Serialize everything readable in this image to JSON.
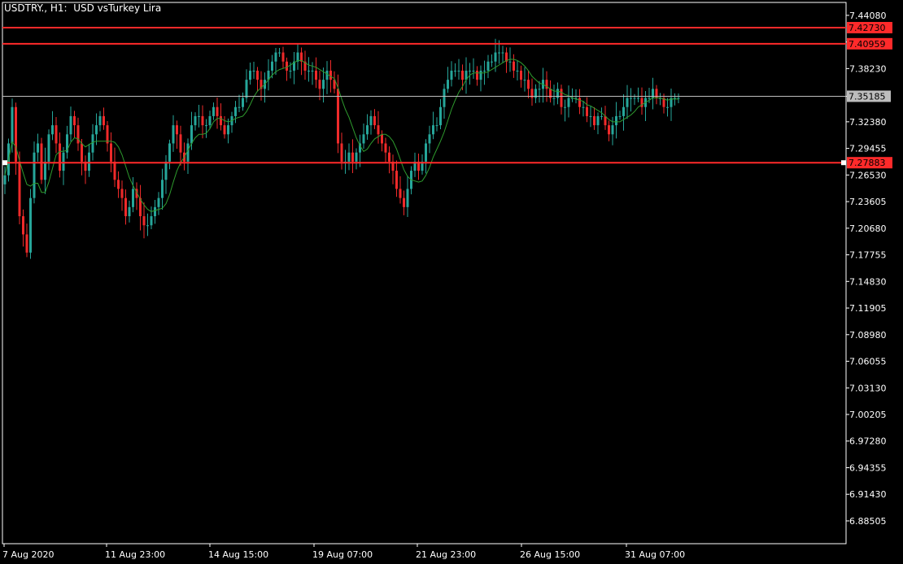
{
  "window": {
    "title": "USDTRY., H1:  USD vsTurkey Lira"
  },
  "colors": {
    "background": "#000000",
    "frame": "#ffffff",
    "bull": "#26a69a",
    "bear": "#ef2a2a",
    "ma": "#2e9b2e",
    "hline": "#ff2a2a",
    "bid_line": "#bdbdbd",
    "text": "#ffffff"
  },
  "chart_data": {
    "type": "candlestick",
    "symbol": "USDTRY.",
    "timeframe": "H1",
    "description": "USD vsTurkey Lira",
    "ylim": [
      6.86,
      7.455
    ],
    "y_ticks": [
      "7.44080",
      "7.41155",
      "7.38230",
      "7.35185",
      "7.32380",
      "7.29455",
      "7.26530",
      "7.23605",
      "7.20680",
      "7.17755",
      "7.14830",
      "7.11905",
      "7.08980",
      "7.06055",
      "7.03130",
      "7.00205",
      "6.97280",
      "6.94355",
      "6.91430",
      "6.88505"
    ],
    "x_ticks": [
      "7 Aug 2020",
      "11 Aug 23:00",
      "14 Aug 15:00",
      "19 Aug 07:00",
      "21 Aug 23:00",
      "26 Aug 15:00",
      "31 Aug 07:00"
    ],
    "bid": 7.35185,
    "levels": [
      {
        "value": 7.4273,
        "label": "7.42730"
      },
      {
        "value": 7.40959,
        "label": "7.40959"
      },
      {
        "value": 7.27883,
        "label": "7.27883"
      }
    ],
    "close_series": [
      7.265,
      7.3,
      7.34,
      7.28,
      7.22,
      7.2,
      7.18,
      7.24,
      7.29,
      7.3,
      7.26,
      7.28,
      7.31,
      7.32,
      7.3,
      7.27,
      7.29,
      7.31,
      7.33,
      7.32,
      7.3,
      7.28,
      7.27,
      7.29,
      7.31,
      7.32,
      7.33,
      7.32,
      7.3,
      7.28,
      7.26,
      7.25,
      7.24,
      7.22,
      7.23,
      7.25,
      7.24,
      7.22,
      7.21,
      7.21,
      7.22,
      7.23,
      7.24,
      7.26,
      7.28,
      7.3,
      7.32,
      7.31,
      7.29,
      7.28,
      7.3,
      7.32,
      7.33,
      7.33,
      7.32,
      7.32,
      7.33,
      7.34,
      7.33,
      7.32,
      7.31,
      7.32,
      7.33,
      7.34,
      7.34,
      7.35,
      7.37,
      7.38,
      7.38,
      7.37,
      7.36,
      7.37,
      7.38,
      7.39,
      7.4,
      7.4,
      7.39,
      7.38,
      7.38,
      7.39,
      7.4,
      7.39,
      7.38,
      7.38,
      7.38,
      7.37,
      7.36,
      7.37,
      7.38,
      7.37,
      7.36,
      7.3,
      7.28,
      7.28,
      7.29,
      7.28,
      7.29,
      7.3,
      7.31,
      7.32,
      7.33,
      7.32,
      7.31,
      7.3,
      7.29,
      7.28,
      7.27,
      7.25,
      7.24,
      7.23,
      7.25,
      7.27,
      7.28,
      7.27,
      7.28,
      7.3,
      7.31,
      7.32,
      7.32,
      7.34,
      7.36,
      7.37,
      7.38,
      7.38,
      7.38,
      7.37,
      7.38,
      7.38,
      7.38,
      7.37,
      7.38,
      7.38,
      7.39,
      7.39,
      7.4,
      7.4,
      7.4,
      7.39,
      7.39,
      7.38,
      7.38,
      7.37,
      7.37,
      7.36,
      7.35,
      7.36,
      7.36,
      7.37,
      7.36,
      7.35,
      7.35,
      7.36,
      7.34,
      7.34,
      7.35,
      7.35,
      7.35,
      7.34,
      7.34,
      7.33,
      7.33,
      7.32,
      7.33,
      7.33,
      7.32,
      7.31,
      7.32,
      7.33,
      7.33,
      7.34,
      7.35,
      7.35,
      7.35,
      7.35,
      7.34,
      7.35,
      7.35,
      7.36,
      7.35,
      7.35,
      7.34,
      7.34,
      7.35,
      7.35,
      7.35
    ]
  }
}
